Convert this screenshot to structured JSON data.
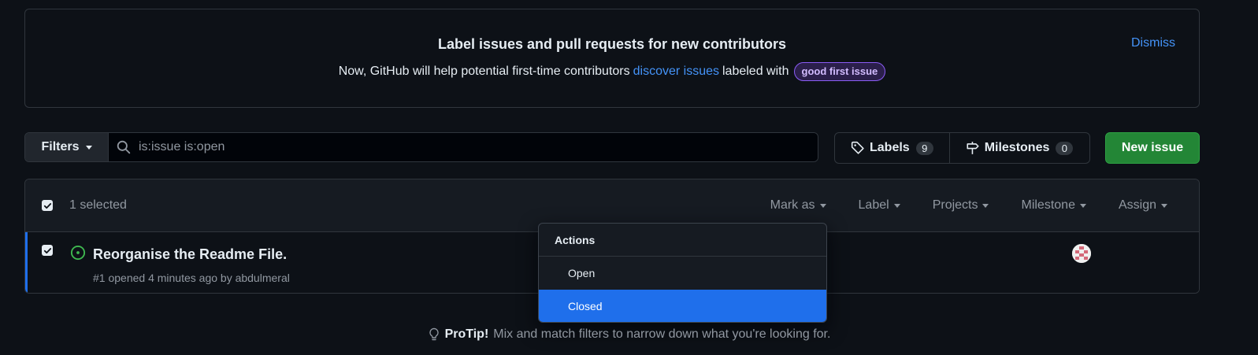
{
  "banner": {
    "title": "Label issues and pull requests for new contributors",
    "text_before": "Now, GitHub will help potential first-time contributors",
    "link_text": "discover issues",
    "text_after": "labeled with",
    "badge": "good first issue",
    "dismiss": "Dismiss"
  },
  "toolbar": {
    "filters_label": "Filters",
    "search_value": "is:issue is:open",
    "labels_label": "Labels",
    "labels_count": "9",
    "milestones_label": "Milestones",
    "milestones_count": "0",
    "new_issue_label": "New issue"
  },
  "issues_header": {
    "selected_text": "1 selected",
    "menus": [
      "Mark as",
      "Label",
      "Projects",
      "Milestone",
      "Assign"
    ]
  },
  "issue": {
    "title": "Reorganise the Readme File.",
    "meta": "#1 opened 4 minutes ago by abdulmeral"
  },
  "dropdown": {
    "header": "Actions",
    "items": [
      "Open",
      "Closed"
    ],
    "selected": "Closed"
  },
  "protip": {
    "bold": "ProTip!",
    "text": "Mix and match filters to narrow down what you're looking for."
  },
  "colors": {
    "background": "#0d1117",
    "accent": "#1f6feb",
    "new_issue_button": "#238636",
    "open_icon": "#3fb950"
  }
}
